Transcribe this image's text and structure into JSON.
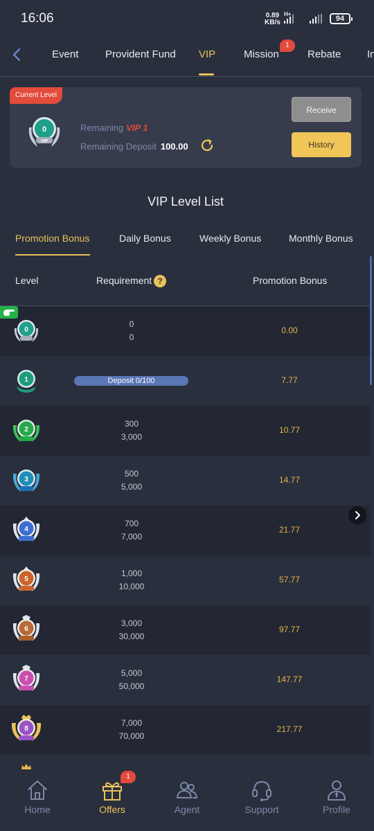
{
  "status_bar": {
    "time": "16:06",
    "speed_value": "0.89",
    "speed_unit": "KB/s",
    "network": "H+",
    "battery": "94"
  },
  "top_tabs": {
    "items": [
      {
        "label": "Event"
      },
      {
        "label": "Provident Fund"
      },
      {
        "label": "VIP"
      },
      {
        "label": "Mission"
      },
      {
        "label": "Rebate"
      },
      {
        "label": "In"
      }
    ],
    "active": "VIP",
    "mission_badge": "1"
  },
  "level_card": {
    "tag": "Current Level",
    "current_level": "0",
    "badge_text": "VIP",
    "remaining_label": "Remaining",
    "remaining_vip": "VIP 1",
    "remaining_deposit_label": "Remaining Deposit",
    "remaining_deposit_value": "100.00",
    "receive_label": "Receive",
    "history_label": "History"
  },
  "list": {
    "title": "VIP Level List",
    "tabs": [
      {
        "label": "Promotion Bonus"
      },
      {
        "label": "Daily Bonus"
      },
      {
        "label": "Weekly Bonus"
      },
      {
        "label": "Monthly Bonus"
      }
    ],
    "active_tab": "Promotion Bonus",
    "headers": {
      "level": "Level",
      "requirement": "Requirement",
      "requirement_help": "?",
      "bonus": "Promotion Bonus"
    },
    "rows": [
      {
        "level": "0",
        "req_top": "0",
        "req_bottom": "0",
        "bonus": "0.00",
        "color": "#1fa08a"
      },
      {
        "level": "1",
        "progress_text": "Deposit 0/100",
        "progress": 0,
        "bonus": "7.77",
        "color": "#1f9c7a"
      },
      {
        "level": "2",
        "req_top": "300",
        "req_bottom": "3,000",
        "bonus": "10.77",
        "color": "#27a84a"
      },
      {
        "level": "3",
        "req_top": "500",
        "req_bottom": "5,000",
        "bonus": "14.77",
        "color": "#1f8fb8"
      },
      {
        "level": "4",
        "req_top": "700",
        "req_bottom": "7,000",
        "bonus": "21.77",
        "color": "#3d6fd0"
      },
      {
        "level": "5",
        "req_top": "1,000",
        "req_bottom": "10,000",
        "bonus": "57.77",
        "color": "#c9662e"
      },
      {
        "level": "6",
        "req_top": "3,000",
        "req_bottom": "30,000",
        "bonus": "97.77",
        "color": "#b86a3a"
      },
      {
        "level": "7",
        "req_top": "5,000",
        "req_bottom": "50,000",
        "bonus": "147.77",
        "color": "#c84fb0"
      },
      {
        "level": "8",
        "req_top": "7,000",
        "req_bottom": "70,000",
        "bonus": "217.77",
        "color": "#9a52c8"
      }
    ]
  },
  "bottom_nav": {
    "items": [
      {
        "label": "Home",
        "icon": "home-icon"
      },
      {
        "label": "Offers",
        "icon": "gift-icon"
      },
      {
        "label": "Agent",
        "icon": "agent-icon"
      },
      {
        "label": "Support",
        "icon": "headset-icon"
      },
      {
        "label": "Profile",
        "icon": "profile-icon"
      }
    ],
    "active": "Offers",
    "offers_badge": "1"
  },
  "colors": {
    "accent": "#e9c25a",
    "background": "#2a2f3d",
    "card": "#363c4c",
    "bonus_value": "#e9b44c",
    "alert": "#e34b3a"
  }
}
